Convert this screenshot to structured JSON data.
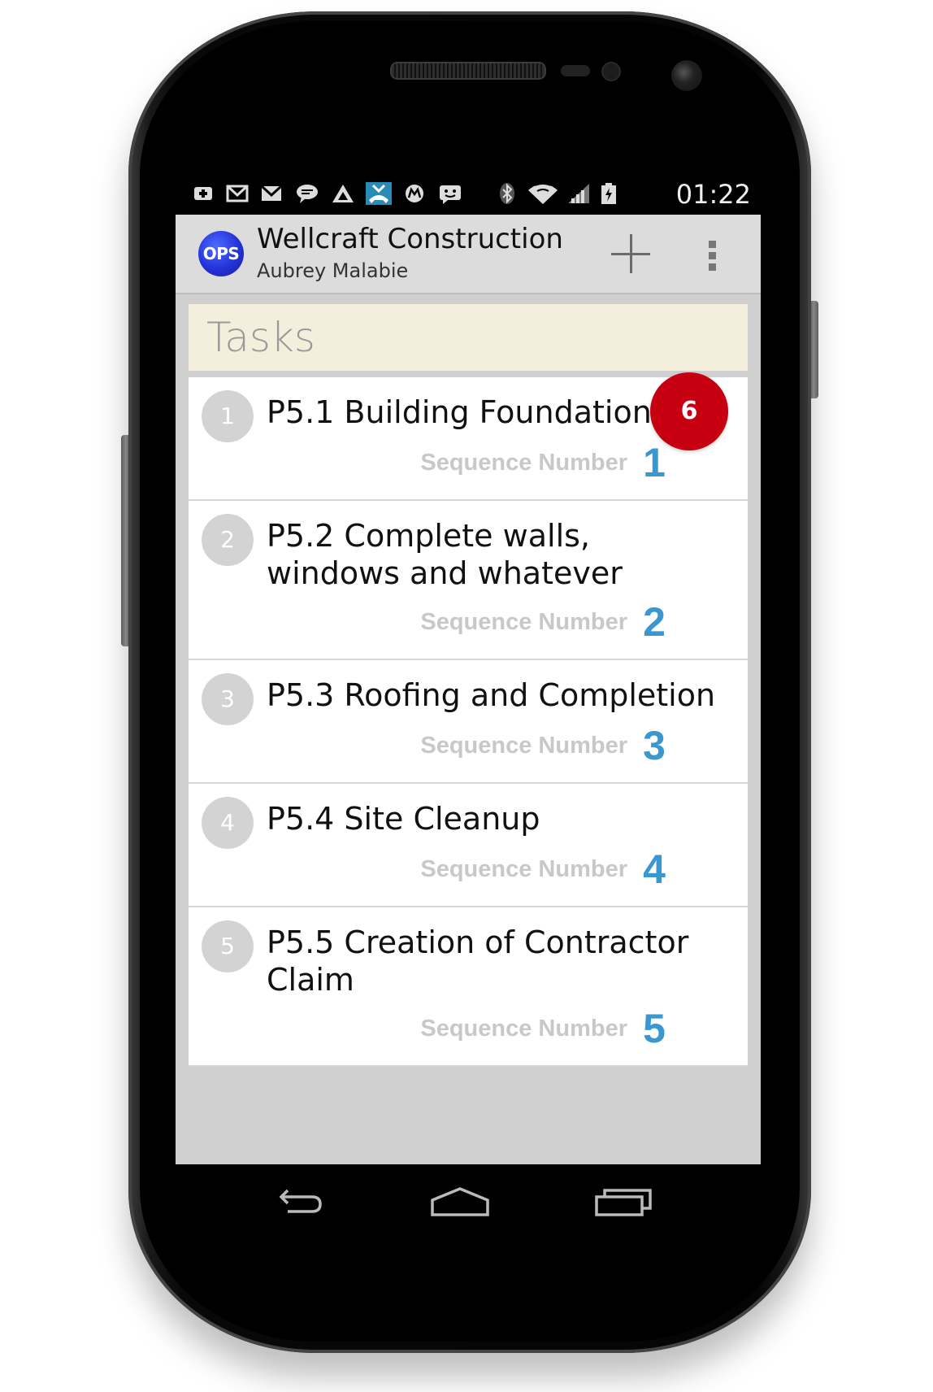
{
  "statusbar": {
    "time": "01:22",
    "icons": [
      "plus-notification-icon",
      "gmail-icon",
      "gmail-icon",
      "chat-bubble-icon",
      "triangle-app-icon",
      "missed-call-icon",
      "motorola-icon",
      "message-icon",
      "bluetooth-icon",
      "wifi-icon",
      "signal-icon",
      "battery-icon"
    ]
  },
  "actionbar": {
    "logo_text": "OPS",
    "title": "Wellcraft Construction",
    "subtitle": "Aubrey Malabie",
    "add_icon": "plus-icon",
    "overflow_icon": "overflow-menu-icon"
  },
  "section": {
    "title": "Tasks",
    "count": "6"
  },
  "tasks": [
    {
      "num": "1",
      "title": "P5.1 Building Foundation",
      "seq_label": "Sequence Number",
      "seq": "1"
    },
    {
      "num": "2",
      "title": "P5.2 Complete walls, windows and whatever",
      "seq_label": "Sequence Number",
      "seq": "2"
    },
    {
      "num": "3",
      "title": "P5.3 Roofing and Completion",
      "seq_label": "Sequence Number",
      "seq": "3"
    },
    {
      "num": "4",
      "title": "P5.4 Site Cleanup",
      "seq_label": "Sequence Number",
      "seq": "4"
    },
    {
      "num": "5",
      "title": "P5.5 Creation of Contractor Claim",
      "seq_label": "Sequence Number",
      "seq": "5"
    }
  ],
  "navbar": {
    "icons": [
      "back-icon",
      "home-icon",
      "recents-icon"
    ]
  },
  "colors": {
    "accent": "#3a97cf",
    "badge": "#c60010",
    "header_bg": "#f4eedc",
    "actionbar_bg": "#dcdcdc"
  }
}
